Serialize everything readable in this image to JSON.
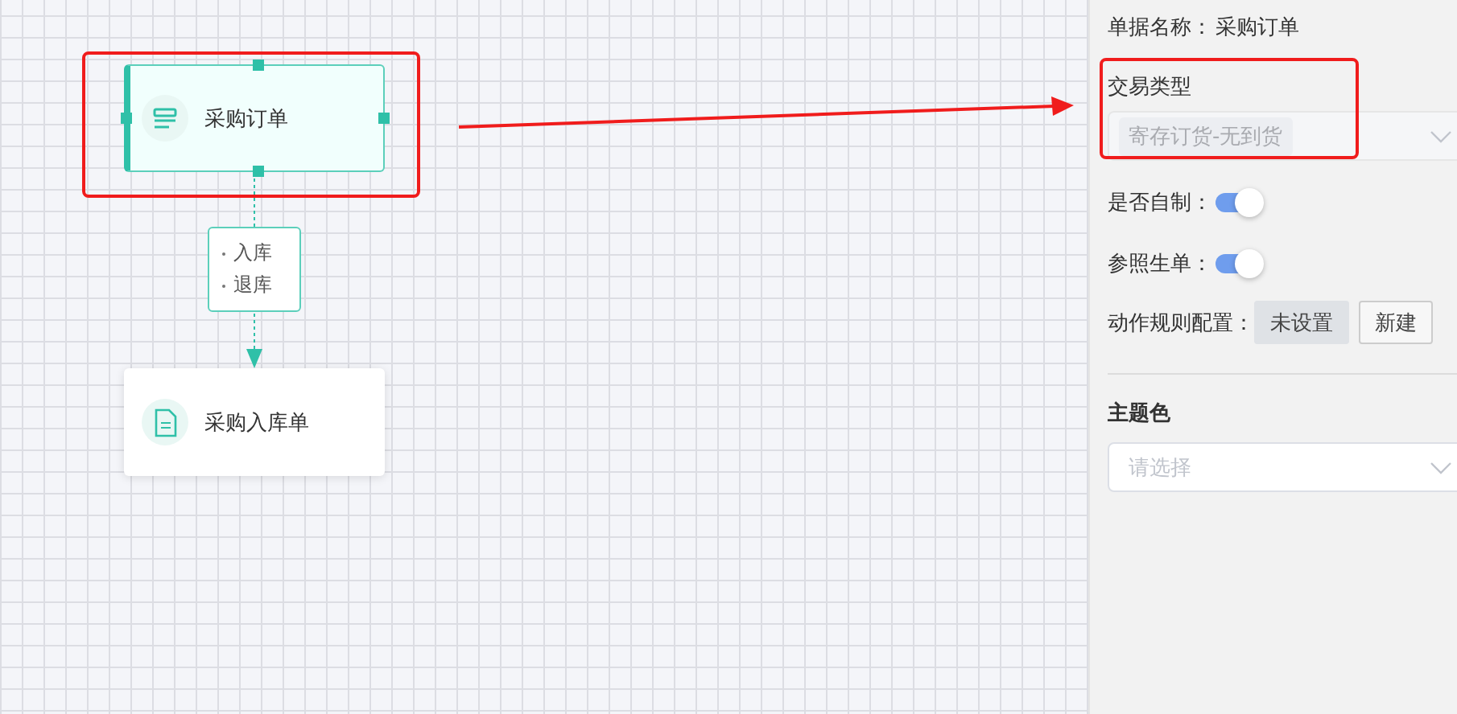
{
  "canvas": {
    "nodes": [
      {
        "label": "采购订单",
        "selected": true,
        "kind": "list"
      },
      {
        "label": "采购入库单",
        "selected": false,
        "kind": "document"
      }
    ],
    "edge_labels": [
      "入库",
      "退库"
    ]
  },
  "panel": {
    "doc_name": {
      "label": "单据名称：",
      "value": "采购订单"
    },
    "trade_type": {
      "label": "交易类型",
      "value": "寄存订货-无到货",
      "disabled": true
    },
    "toggles": [
      {
        "label": "是否自制：",
        "on": true
      },
      {
        "label": "参照生单：",
        "on": true
      }
    ],
    "rules": {
      "label": "动作规则配置：",
      "buttons": [
        "未设置",
        "新建"
      ]
    },
    "theme": {
      "title": "主题色",
      "placeholder": "请选择"
    }
  }
}
